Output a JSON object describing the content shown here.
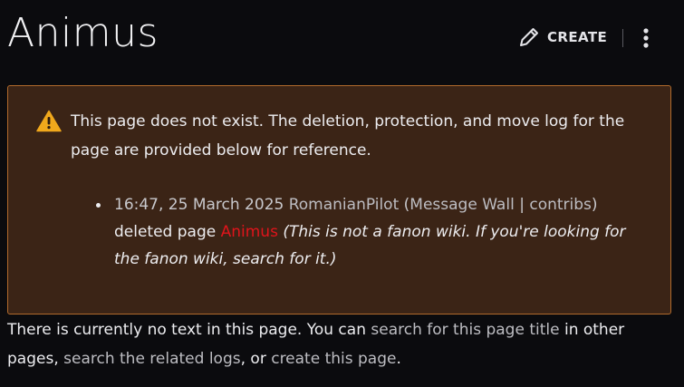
{
  "header": {
    "title": "Animus",
    "create_label": "CREATE"
  },
  "notice": {
    "text": "This page does not exist. The deletion, protection, and move log for the page are provided below for reference.",
    "log_entries": [
      {
        "timestamp": "16:47, 25 March 2025",
        "user": "RomanianPilot",
        "open_paren": " (",
        "message_wall": "Message Wall",
        "separator": " | ",
        "contribs": "contribs",
        "close_paren": ")",
        "action": "deleted page ",
        "page": "Animus",
        "reason": "(This is not a fanon wiki. If you're looking for the fanon wiki, search for it.)"
      }
    ]
  },
  "footer": {
    "text_1": "There is currently no text in this page. You can ",
    "link_search_title": "search for this page title",
    "text_2": " in other pages, ",
    "link_search_logs": "search the related logs",
    "text_3": ", or ",
    "link_create": "create this page",
    "text_4": "."
  },
  "colors": {
    "background": "#0b0b0e",
    "notice_background": "#3b2416",
    "notice_border": "#b06a2c",
    "warning": "#f0a81c",
    "red_link": "#e0141b"
  },
  "icons": {
    "create": "pencil-icon",
    "more": "vertical-ellipsis-icon",
    "warning": "warning-triangle-icon"
  }
}
